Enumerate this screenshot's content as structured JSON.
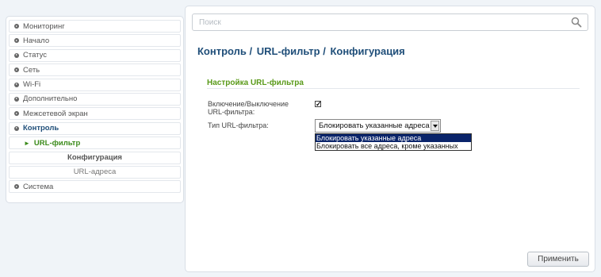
{
  "sidebar": {
    "items": [
      {
        "label": "Мониторинг"
      },
      {
        "label": "Начало"
      },
      {
        "label": "Статус"
      },
      {
        "label": "Сеть"
      },
      {
        "label": "Wi-Fi"
      },
      {
        "label": "Дополнительно"
      },
      {
        "label": "Межсетевой экран"
      },
      {
        "label": "Контроль"
      },
      {
        "label": "URL-фильтр"
      },
      {
        "label": "Конфигурация"
      },
      {
        "label": "URL-адреса"
      },
      {
        "label": "Система"
      }
    ]
  },
  "search": {
    "placeholder": "Поиск"
  },
  "breadcrumb": {
    "part1": "Контроль /",
    "part2": "URL-фильтр /",
    "part3": "Конфигурация"
  },
  "section": {
    "title": "Настройка URL-фильтра"
  },
  "form": {
    "enable_label": "Включение/Выключение URL-фильтра:",
    "enable_checked": true,
    "type_label": "Тип URL-фильтра:",
    "type_value": "Блокировать указанные адреса",
    "type_options": [
      "Блокировать указанные адреса",
      "Блокировать все адреса, кроме указанных"
    ]
  },
  "actions": {
    "apply_label": "Применить"
  },
  "colors": {
    "accent_green": "#5a9a1a",
    "title_blue": "#1f4e79",
    "selected_bg": "#0a246a"
  }
}
